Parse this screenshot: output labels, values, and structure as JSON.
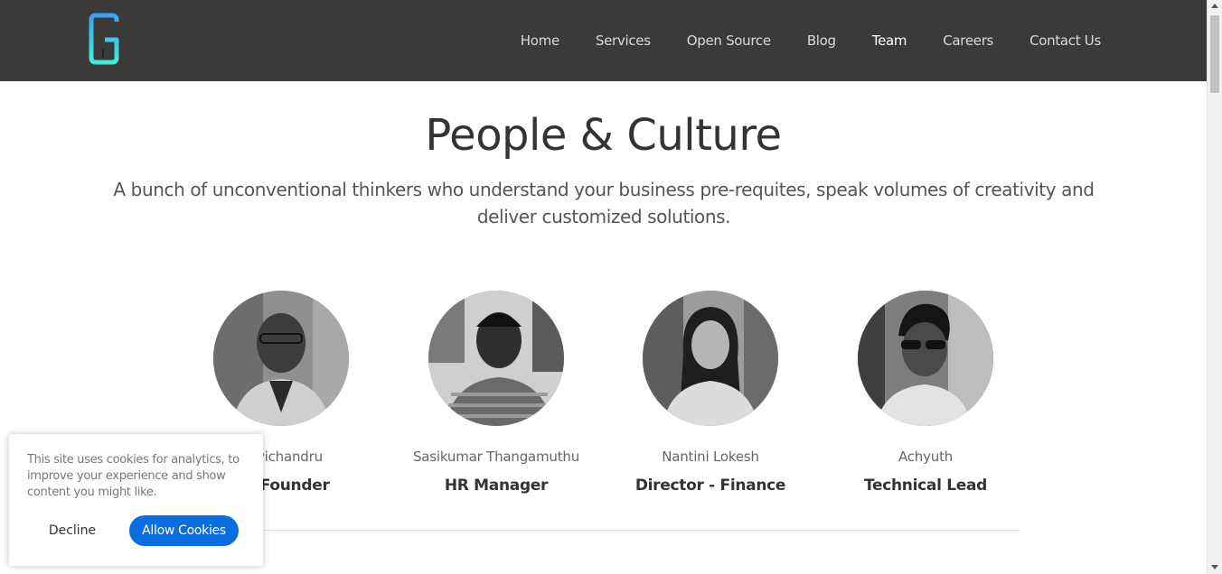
{
  "header": {
    "logo_icon": "g-logo-icon",
    "nav": [
      {
        "label": "Home"
      },
      {
        "label": "Services"
      },
      {
        "label": "Open Source"
      },
      {
        "label": "Blog"
      },
      {
        "label": "Team",
        "active": true
      },
      {
        "label": "Careers"
      },
      {
        "label": "Contact Us"
      }
    ]
  },
  "hero": {
    "title": "People & Culture",
    "subtitle": "A bunch of unconventional thinkers who understand your business pre-requites, speak volumes of creativity and deliver customized solutions."
  },
  "team": [
    {
      "name": "Ravichandru",
      "role": "Co-Founder"
    },
    {
      "name": "Sasikumar Thangamuthu",
      "role": "HR Manager"
    },
    {
      "name": "Nantini Lokesh",
      "role": "Director - Finance"
    },
    {
      "name": "Achyuth",
      "role": "Technical Lead"
    }
  ],
  "cookie_banner": {
    "text": "This site uses cookies for analytics, to improve your experience and show content you might like.",
    "decline_label": "Decline",
    "allow_label": "Allow Cookies"
  },
  "colors": {
    "header_bg": "#3b3a39",
    "accent_button": "#0a6de0",
    "logo_gradient_top": "#3aa0f0",
    "logo_gradient_bottom": "#3ff0d0"
  }
}
